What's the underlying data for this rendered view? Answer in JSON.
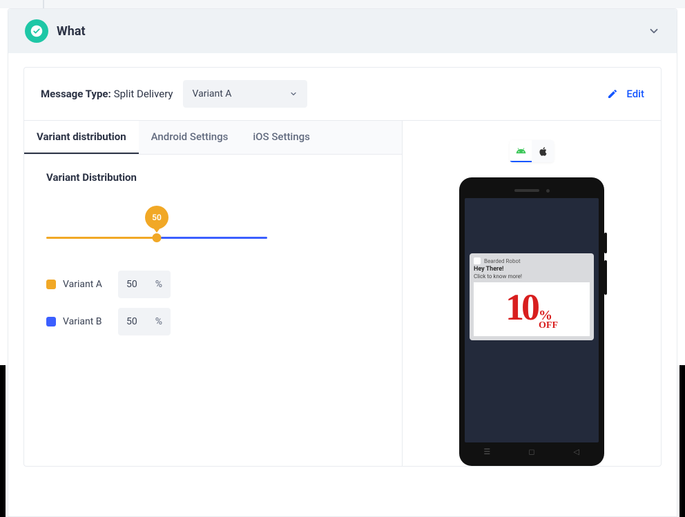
{
  "header": {
    "title": "What"
  },
  "messageType": {
    "label": "Message Type:",
    "value": "Split Delivery"
  },
  "variantSelect": {
    "selected": "Variant A"
  },
  "editLabel": "Edit",
  "tabs": {
    "distribution": "Variant distribution",
    "android": "Android Settings",
    "ios": "iOS Settings"
  },
  "distribution": {
    "title": "Variant Distribution",
    "sliderValue": "50",
    "variants": [
      {
        "label": "Variant A",
        "value": "50",
        "unit": "%"
      },
      {
        "label": "Variant B",
        "value": "50",
        "unit": "%"
      }
    ]
  },
  "preview": {
    "notification": {
      "app": "Bearded Robot",
      "title": "Hey There!",
      "body": "Click to know more!",
      "promoNumber": "10",
      "promoPercent": "%",
      "promoOff": "OFF"
    }
  }
}
